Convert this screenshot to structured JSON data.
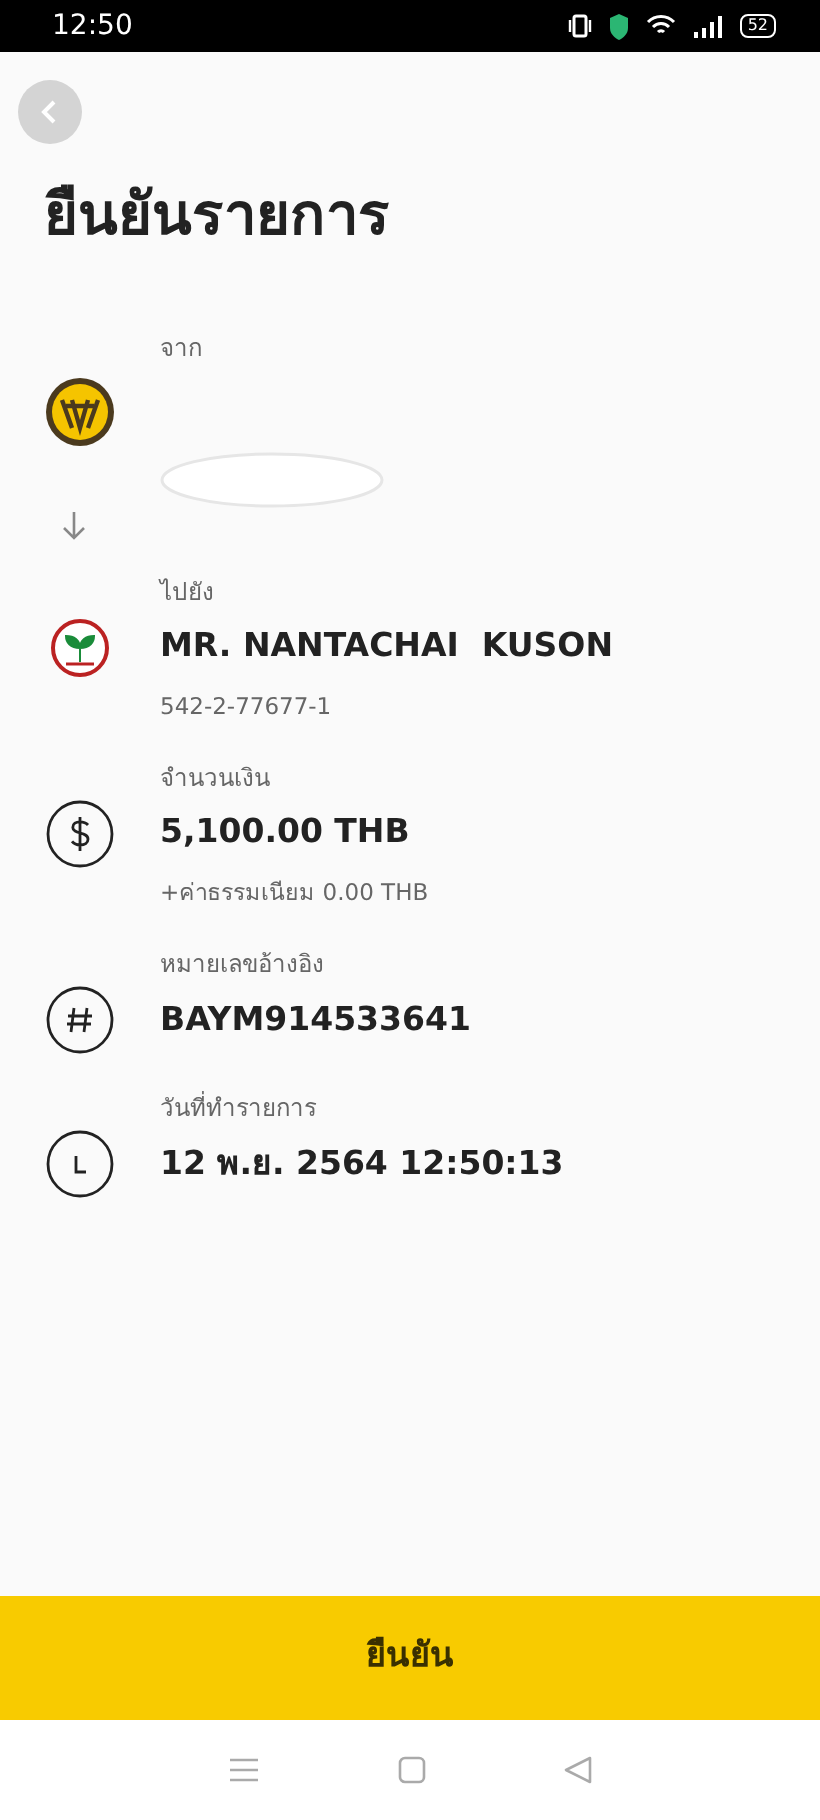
{
  "status_bar": {
    "time": "12:50",
    "battery": "52"
  },
  "title": "ยืนยันรายการ",
  "sender": {
    "label": "จาก"
  },
  "recipient": {
    "label": "ไปยัง",
    "name": "MR. NANTACHAI  KUSON",
    "account": "542-2-77677-1"
  },
  "details": [
    {
      "kind": "amount",
      "label": "จำนวนเงิน",
      "value": "5,100.00 THB",
      "note": "+ค่าธรรมเนียม 0.00 THB"
    },
    {
      "kind": "reference",
      "label": "หมายเลขอ้างอิง",
      "value": "BAYM914533641"
    },
    {
      "kind": "datetime",
      "label": "วันที่ทำรายการ",
      "value": "12 พ.ย. 2564 12:50:13"
    }
  ],
  "confirm_button": "ยืนยัน"
}
